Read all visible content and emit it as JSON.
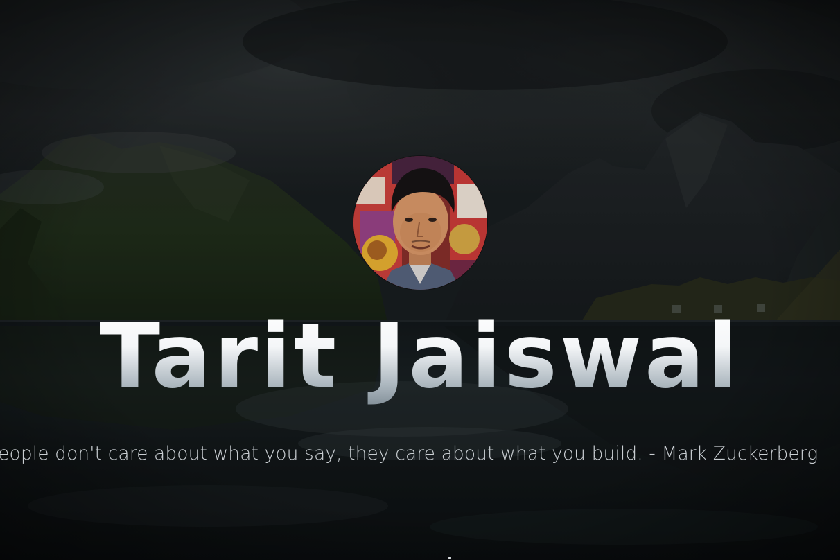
{
  "hero": {
    "name": "Tarit Jaiswal",
    "quote": "People don't care about what you say, they care about what you build. - Mark Zuckerberg",
    "avatar_alt": "Tarit Jaiswal profile photo"
  },
  "icons": {
    "scroll_indicator": "scroll-down-indicator"
  }
}
